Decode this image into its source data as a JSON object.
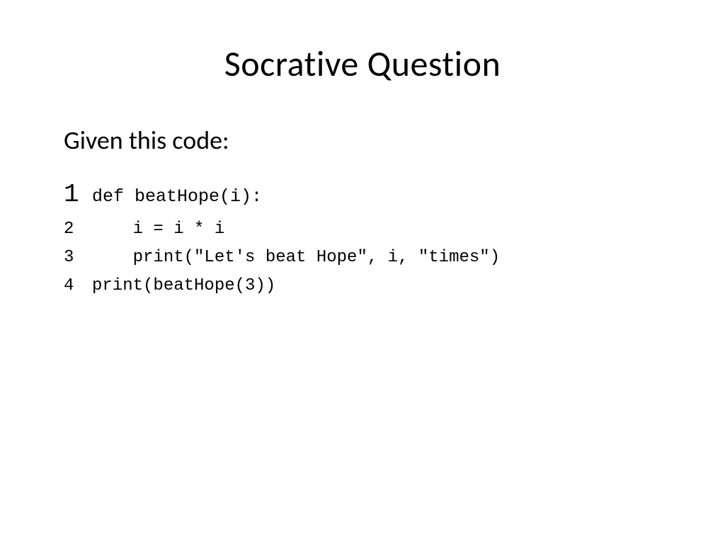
{
  "slide": {
    "title": "Socrative Question",
    "prompt": "Given this code:",
    "code": {
      "lines": [
        {
          "num": "1",
          "text": "def beatHope(i):",
          "firstLine": true
        },
        {
          "num": "2",
          "text": "    i = i * i"
        },
        {
          "num": "3",
          "text": "    print(\"Let's beat Hope\", i, \"times\")"
        },
        {
          "num": "4",
          "text": "print(beatHope(3))"
        }
      ]
    }
  }
}
